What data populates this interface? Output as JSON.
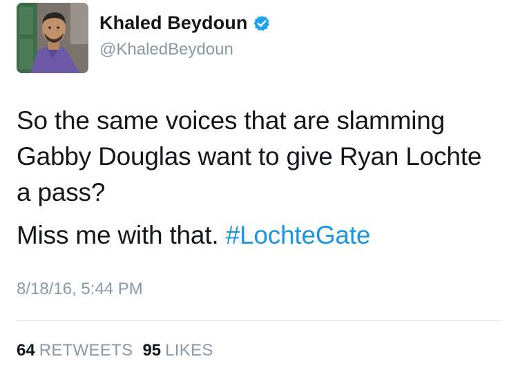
{
  "user": {
    "display_name": "Khaled Beydoun",
    "handle": "@KhaledBeydoun",
    "verified": true
  },
  "tweet": {
    "text_line1": "So the same voices that are slamming Gabby Douglas want to give Ryan Lochte a pass?",
    "text_line2": "Miss me with that.",
    "hashtag": "#LochteGate",
    "timestamp": "8/18/16, 5:44 PM"
  },
  "stats": {
    "retweets_count": "64",
    "retweets_label": "RETWEETS",
    "likes_count": "95",
    "likes_label": "LIKES"
  },
  "colors": {
    "hashtag": "#1b95e0",
    "secondary": "#8899a6",
    "verified": "#1da1f2"
  },
  "icons": {
    "verified": "verified-badge-icon",
    "avatar": "profile-photo"
  }
}
